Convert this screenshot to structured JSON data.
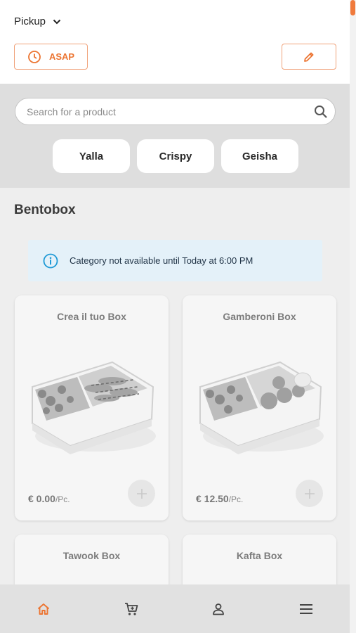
{
  "header": {
    "service_mode": "Pickup",
    "asap_label": "ASAP"
  },
  "search": {
    "placeholder": "Search for a product"
  },
  "chips": [
    "Yalla",
    "Crispy",
    "Geisha"
  ],
  "category": {
    "title": "Bentobox",
    "notice": "Category not available until Today at 6:00 PM"
  },
  "products": [
    {
      "name": "Crea il tuo Box",
      "price": "€ 0.00",
      "unit": "/Pc."
    },
    {
      "name": "Gamberoni Box",
      "price": "€ 12.50",
      "unit": "/Pc."
    },
    {
      "name": "Tawook Box"
    },
    {
      "name": "Kafta Box"
    }
  ],
  "colors": {
    "accent": "#ec7532",
    "info": "#1f9ad6",
    "notice_bg": "#e4f1f9"
  },
  "nav": [
    "home-icon",
    "cart-icon",
    "user-icon",
    "menu-icon"
  ]
}
